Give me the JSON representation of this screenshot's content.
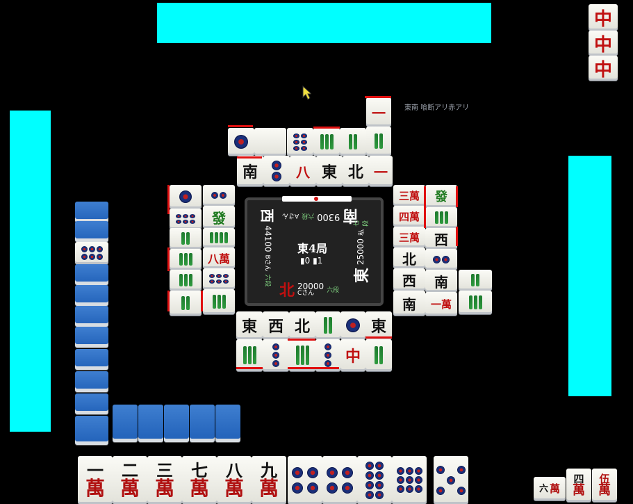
{
  "rule_text": "東南 喰断アリ赤アリ",
  "center": {
    "round": "東4局",
    "honba": "0",
    "riichi_sticks": "1",
    "south": {
      "wind": "南",
      "score": "9300",
      "name": "Aさん",
      "rank": "六段"
    },
    "west": {
      "wind": "西",
      "score": "44100",
      "name": "Bさん",
      "rank": "六段"
    },
    "east": {
      "wind": "東",
      "score": "25000",
      "name": "私",
      "rank": "七段"
    },
    "north": {
      "wind": "北",
      "score": "20000",
      "name": "Cさん",
      "rank": "六段"
    }
  },
  "dora_indicator_topright": [
    "中",
    "中",
    "中"
  ],
  "player_hand": [
    {
      "num": "一",
      "suit": "萬"
    },
    {
      "num": "二",
      "suit": "萬"
    },
    {
      "num": "三",
      "suit": "萬"
    },
    {
      "num": "七",
      "suit": "萬"
    },
    {
      "num": "八",
      "suit": "萬"
    },
    {
      "num": "九",
      "suit": "萬"
    },
    {
      "pins": 4
    },
    {
      "pins": 4
    },
    {
      "pins": 8
    },
    {
      "pins": 9
    },
    {
      "pins": 5
    }
  ],
  "bottom_right_meld": [
    {
      "num": "六",
      "suit": "萬"
    },
    {
      "num": "四",
      "suit": "萬"
    },
    {
      "num": "伍",
      "suit": "萬"
    }
  ],
  "discards_top": [
    "南",
    "8p",
    "東",
    "北",
    "一萬"
  ],
  "discards_bottom": [
    "東",
    "西",
    "北",
    "8s",
    "1p",
    "東",
    "3s",
    "3p",
    "9s",
    "3p",
    "中",
    "2s"
  ],
  "discards_left": [
    "1p",
    "4p",
    "9p",
    "發",
    "4s",
    "9s",
    "9s",
    "八萬",
    "9s",
    "9p",
    "3s",
    "4s"
  ],
  "discards_right": [
    "三萬",
    "發",
    "四萬",
    "9s",
    "三萬",
    "西",
    "北",
    "2p",
    "西",
    "南",
    "南",
    "一萬",
    "4s",
    "9s"
  ]
}
